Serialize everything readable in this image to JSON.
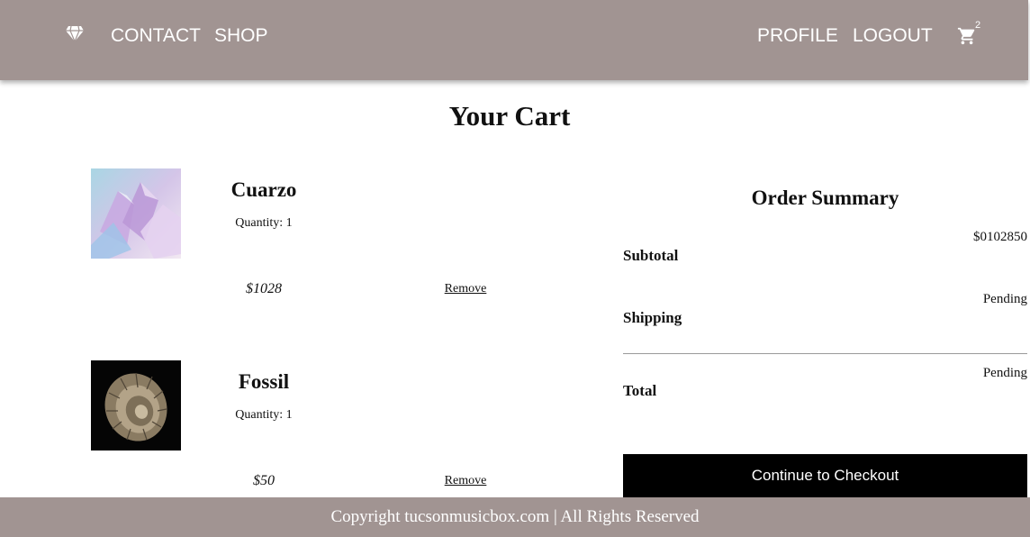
{
  "nav": {
    "logo_icon": "diamond-icon",
    "left_links": [
      "CONTACT",
      "SHOP"
    ],
    "right_links": [
      "PROFILE",
      "LOGOUT"
    ],
    "cart_icon": "cart-icon",
    "cart_count": "2"
  },
  "page": {
    "title": "Your Cart"
  },
  "cart": {
    "items": [
      {
        "name": "Cuarzo",
        "quantity": "Quantity: 1",
        "price": "$1028",
        "remove_label": "Remove",
        "image": "quartz-crystal-photo"
      },
      {
        "name": "Fossil",
        "quantity": "Quantity: 1",
        "price": "$50",
        "remove_label": "Remove",
        "image": "ammonite-fossil-photo"
      }
    ]
  },
  "summary": {
    "title": "Order Summary",
    "subtotal_label": "Subtotal",
    "subtotal_value": "$0102850",
    "shipping_label": "Shipping",
    "shipping_value": "Pending",
    "total_label": "Total",
    "total_value": "Pending",
    "checkout_label": "Continue to Checkout"
  },
  "footer": {
    "text": "Copyright tucsonmusicbox.com | All Rights Reserved"
  },
  "colors": {
    "header_bg": "#a19492",
    "footer_bg": "#a19492",
    "checkout_bg": "#000000",
    "text_light": "#ffffff"
  }
}
